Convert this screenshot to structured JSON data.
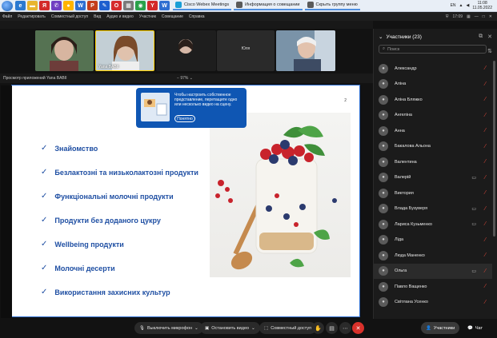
{
  "taskbar": {
    "tasks": [
      {
        "label": "Cisco Webex Meetings",
        "color": "#1a9fd6"
      },
      {
        "label": "Информация о совещании",
        "color": "#5a5a5a"
      },
      {
        "label": "Скрыть группу меню",
        "color": "#5a5a5a"
      }
    ],
    "tray": {
      "lang": "EN",
      "time": "11:08",
      "date": "11.05.2022"
    }
  },
  "menubar": {
    "items": [
      "Файл",
      "Редактировать",
      "Совместный доступ",
      "Вид",
      "Аудио и видео",
      "Участник",
      "Совещание",
      "Справка"
    ],
    "clock": "17:09"
  },
  "videos": [
    {
      "name": "",
      "bg": "#5b7a5a"
    },
    {
      "name": "Yana BABII",
      "bg": "#b9c7cf"
    },
    {
      "name": "",
      "bg": "#1e1e1e"
    },
    {
      "name": "Юля",
      "bg": "#2a2a2a"
    },
    {
      "name": "",
      "bg": "#6a8aa6"
    }
  ],
  "share": {
    "title": "Просмотр приложений Yana BABII",
    "zoom": "97%"
  },
  "slide": {
    "page": "2",
    "bullets": [
      "Знайомство",
      "Безлактозні та низьколактозні продукти",
      "Функціональні молочні продукти",
      "Продукти без доданого цукру",
      "Wellbeing продукти",
      "Молочні десерти",
      "Використання захисних культур"
    ]
  },
  "popup": {
    "text": "Чтобы настроить собственное представление, перетащите одно или несколько видео на сцену.",
    "button": "Понятно"
  },
  "controls": {
    "mute": "Выключить микрофон",
    "video": "Остановить видео",
    "share": "Совместный доступ",
    "participants": "Участники",
    "chat": "Чат"
  },
  "panel": {
    "title": "Участники (23)",
    "search_placeholder": "Поиск",
    "participants": [
      {
        "name": "Александр",
        "cam": false,
        "active": false
      },
      {
        "name": "Аліна",
        "cam": false,
        "active": false
      },
      {
        "name": "Аліна Бляжко",
        "cam": false,
        "active": false
      },
      {
        "name": "Ангеліна",
        "cam": false,
        "active": false
      },
      {
        "name": "Анна",
        "cam": false,
        "active": false
      },
      {
        "name": "Бакалова Альона",
        "cam": false,
        "active": false
      },
      {
        "name": "Валентина",
        "cam": false,
        "active": false
      },
      {
        "name": "Валерій",
        "cam": true,
        "active": false
      },
      {
        "name": "Виктория",
        "cam": false,
        "active": false
      },
      {
        "name": "Влада Бузуверя",
        "cam": true,
        "active": false
      },
      {
        "name": "Лариса Кузьменко",
        "cam": true,
        "active": false
      },
      {
        "name": "Ліда",
        "cam": false,
        "active": false
      },
      {
        "name": "Люда Маненко",
        "cam": false,
        "active": false
      },
      {
        "name": "Ольга",
        "cam": true,
        "active": true
      },
      {
        "name": "Павло Ващенко",
        "cam": false,
        "active": false
      },
      {
        "name": "Світлана Усенко",
        "cam": false,
        "active": false
      }
    ]
  },
  "colors": {
    "accent": "#0f56b3",
    "slide_text": "#1f4fa3",
    "muted": "#e0473a"
  }
}
